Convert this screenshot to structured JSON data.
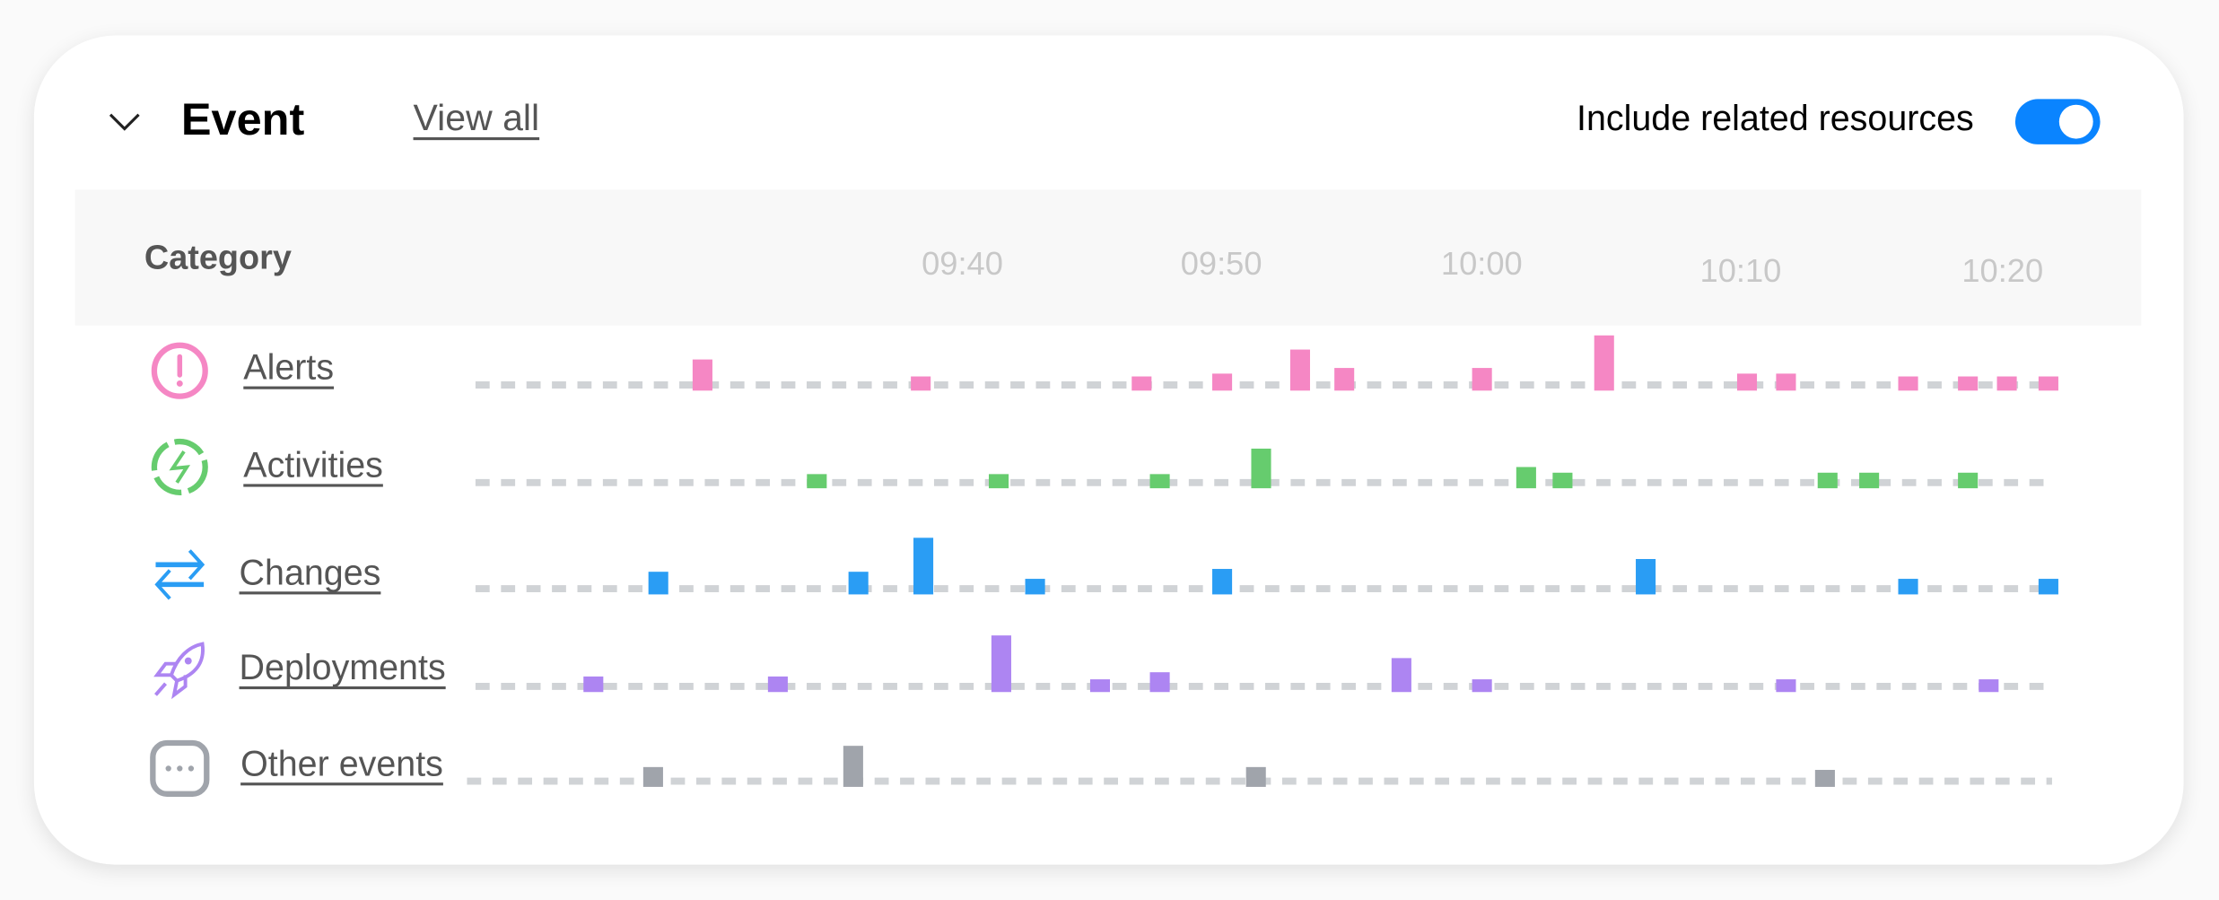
{
  "header": {
    "title": "Event",
    "view_all": "View all",
    "include_related_label": "Include related resources",
    "include_related_on": true
  },
  "table": {
    "category_header": "Category"
  },
  "chart_data": {
    "type": "scatter",
    "x_ticks": [
      "09:40",
      "09:50",
      "10:00",
      "10:10",
      "10:20"
    ],
    "rows": [
      {
        "label": "Alerts",
        "icon": "alert-circle-icon",
        "color": "#f587c4",
        "events": [
          [
            "09:30:00",
            2.2
          ],
          [
            "09:38:24",
            1
          ],
          [
            "09:46:54",
            1
          ],
          [
            "09:50:00",
            1.2
          ],
          [
            "09:53:00",
            2.9
          ],
          [
            "09:54:42",
            1.6
          ],
          [
            "10:00:00",
            1.6
          ],
          [
            "10:04:42",
            3.9
          ],
          [
            "10:10:12",
            1.2
          ],
          [
            "10:11:42",
            1.2
          ],
          [
            "10:16:24",
            1
          ],
          [
            "10:18:42",
            1
          ],
          [
            "10:20:12",
            1
          ],
          [
            "10:21:48",
            1
          ]
        ]
      },
      {
        "label": "Activities",
        "icon": "activity-bolt-icon",
        "color": "#66cc6e",
        "events": [
          [
            "09:34:24",
            1
          ],
          [
            "09:41:24",
            1
          ],
          [
            "09:47:36",
            1
          ],
          [
            "09:51:30",
            2.8
          ],
          [
            "10:01:42",
            1.5
          ],
          [
            "10:03:06",
            1.1
          ],
          [
            "10:13:18",
            1.1
          ],
          [
            "10:14:54",
            1.1
          ],
          [
            "10:18:42",
            1.1
          ]
        ]
      },
      {
        "label": "Changes",
        "icon": "swap-arrows-icon",
        "color": "#2a9df4",
        "events": [
          [
            "09:28:18",
            1.6
          ],
          [
            "09:36:00",
            1.6
          ],
          [
            "09:38:30",
            4
          ],
          [
            "09:42:48",
            1.1
          ],
          [
            "09:50:00",
            1.8
          ],
          [
            "10:06:18",
            2.5
          ],
          [
            "10:16:24",
            1.1
          ],
          [
            "10:21:48",
            1.1
          ]
        ]
      },
      {
        "label": "Deployments",
        "icon": "rocket-icon",
        "color": "#ad85f2",
        "events": [
          [
            "09:25:48",
            1.1
          ],
          [
            "09:32:54",
            1.1
          ],
          [
            "09:41:30",
            4
          ],
          [
            "09:45:18",
            0.9
          ],
          [
            "09:47:36",
            1.4
          ],
          [
            "09:56:54",
            2.4
          ],
          [
            "10:00:00",
            0.9
          ],
          [
            "10:11:42",
            0.9
          ],
          [
            "10:19:30",
            0.9
          ]
        ]
      },
      {
        "label": "Other events",
        "icon": "more-dots-icon",
        "color": "#a0a4ab",
        "events": [
          [
            "09:28:06",
            1.4
          ],
          [
            "09:35:48",
            2.9
          ],
          [
            "09:51:18",
            1.4
          ],
          [
            "10:13:12",
            1.2
          ]
        ]
      }
    ]
  }
}
